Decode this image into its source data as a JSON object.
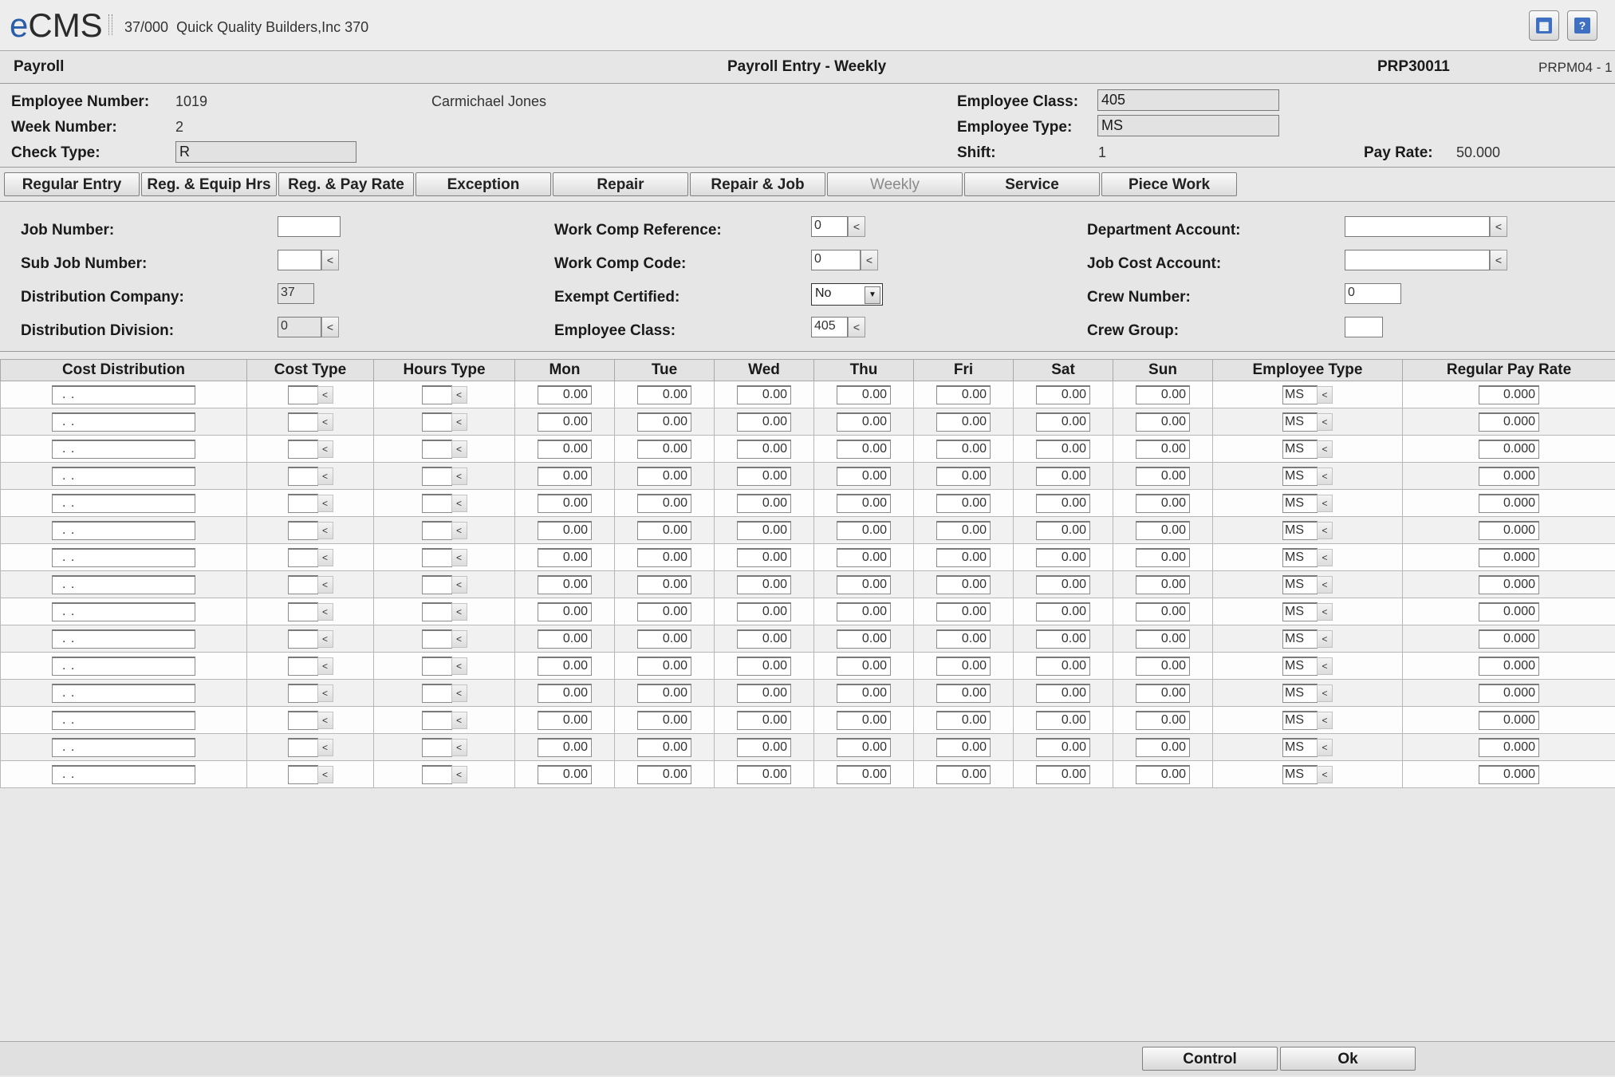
{
  "app": {
    "logo": "eCMS",
    "company_code": "37/000",
    "company_name": "Quick Quality Builders,Inc 370"
  },
  "title_bar": {
    "module": "Payroll",
    "screen": "Payroll Entry - Weekly",
    "program": "PRP30011",
    "screen_id": "PRPM04 - 1"
  },
  "header": {
    "employee_number_label": "Employee Number:",
    "employee_number": "1019",
    "employee_name": "Carmichael Jones",
    "week_number_label": "Week Number:",
    "week_number": "2",
    "check_type_label": "Check Type:",
    "check_type": "R",
    "employee_class_label": "Employee Class:",
    "employee_class": "405",
    "employee_type_label": "Employee Type:",
    "employee_type": "MS",
    "shift_label": "Shift:",
    "shift": "1",
    "pay_rate_label": "Pay Rate:",
    "pay_rate": "50.000"
  },
  "tabs": [
    {
      "label": "Regular Entry",
      "enabled": true
    },
    {
      "label": "Reg. & Equip Hrs",
      "enabled": true
    },
    {
      "label": "Reg. & Pay Rate",
      "enabled": true
    },
    {
      "label": "Exception",
      "enabled": true
    },
    {
      "label": "Repair",
      "enabled": true
    },
    {
      "label": "Repair & Job",
      "enabled": true
    },
    {
      "label": "Weekly",
      "enabled": false
    },
    {
      "label": "Service",
      "enabled": true
    },
    {
      "label": "Piece Work",
      "enabled": true
    }
  ],
  "form": {
    "job_number_label": "Job Number:",
    "job_number": "",
    "sub_job_number_label": "Sub Job Number:",
    "sub_job_number": "",
    "distribution_company_label": "Distribution Company:",
    "distribution_company": "37",
    "distribution_division_label": "Distribution Division:",
    "distribution_division": "0",
    "work_comp_reference_label": "Work Comp Reference:",
    "work_comp_reference": "0",
    "work_comp_code_label": "Work Comp Code:",
    "work_comp_code": "0",
    "exempt_certified_label": "Exempt Certified:",
    "exempt_certified": "No",
    "employee_class_label": "Employee Class:",
    "employee_class": "405",
    "department_account_label": "Department Account:",
    "department_account": "",
    "job_cost_account_label": "Job Cost Account:",
    "job_cost_account": "",
    "crew_number_label": "Crew Number:",
    "crew_number": "0",
    "crew_group_label": "Crew Group:",
    "crew_group": ""
  },
  "grid": {
    "columns": [
      "Cost Distribution",
      "Cost Type",
      "Hours Type",
      "Mon",
      "Tue",
      "Wed",
      "Thu",
      "Fri",
      "Sat",
      "Sun",
      "Employee Type",
      "Regular Pay Rate"
    ],
    "rows": [
      {
        "cost_distribution": ".   .",
        "cost_type": "",
        "hours_type": "",
        "mon": "0.00",
        "tue": "0.00",
        "wed": "0.00",
        "thu": "0.00",
        "fri": "0.00",
        "sat": "0.00",
        "sun": "0.00",
        "employee_type": "MS",
        "regular_pay_rate": "0.000"
      },
      {
        "cost_distribution": ".   .",
        "cost_type": "",
        "hours_type": "",
        "mon": "0.00",
        "tue": "0.00",
        "wed": "0.00",
        "thu": "0.00",
        "fri": "0.00",
        "sat": "0.00",
        "sun": "0.00",
        "employee_type": "MS",
        "regular_pay_rate": "0.000"
      },
      {
        "cost_distribution": ".   .",
        "cost_type": "",
        "hours_type": "",
        "mon": "0.00",
        "tue": "0.00",
        "wed": "0.00",
        "thu": "0.00",
        "fri": "0.00",
        "sat": "0.00",
        "sun": "0.00",
        "employee_type": "MS",
        "regular_pay_rate": "0.000"
      },
      {
        "cost_distribution": ".   .",
        "cost_type": "",
        "hours_type": "",
        "mon": "0.00",
        "tue": "0.00",
        "wed": "0.00",
        "thu": "0.00",
        "fri": "0.00",
        "sat": "0.00",
        "sun": "0.00",
        "employee_type": "MS",
        "regular_pay_rate": "0.000"
      },
      {
        "cost_distribution": ".   .",
        "cost_type": "",
        "hours_type": "",
        "mon": "0.00",
        "tue": "0.00",
        "wed": "0.00",
        "thu": "0.00",
        "fri": "0.00",
        "sat": "0.00",
        "sun": "0.00",
        "employee_type": "MS",
        "regular_pay_rate": "0.000"
      },
      {
        "cost_distribution": ".   .",
        "cost_type": "",
        "hours_type": "",
        "mon": "0.00",
        "tue": "0.00",
        "wed": "0.00",
        "thu": "0.00",
        "fri": "0.00",
        "sat": "0.00",
        "sun": "0.00",
        "employee_type": "MS",
        "regular_pay_rate": "0.000"
      },
      {
        "cost_distribution": ".   .",
        "cost_type": "",
        "hours_type": "",
        "mon": "0.00",
        "tue": "0.00",
        "wed": "0.00",
        "thu": "0.00",
        "fri": "0.00",
        "sat": "0.00",
        "sun": "0.00",
        "employee_type": "MS",
        "regular_pay_rate": "0.000"
      },
      {
        "cost_distribution": ".   .",
        "cost_type": "",
        "hours_type": "",
        "mon": "0.00",
        "tue": "0.00",
        "wed": "0.00",
        "thu": "0.00",
        "fri": "0.00",
        "sat": "0.00",
        "sun": "0.00",
        "employee_type": "MS",
        "regular_pay_rate": "0.000"
      },
      {
        "cost_distribution": ".   .",
        "cost_type": "",
        "hours_type": "",
        "mon": "0.00",
        "tue": "0.00",
        "wed": "0.00",
        "thu": "0.00",
        "fri": "0.00",
        "sat": "0.00",
        "sun": "0.00",
        "employee_type": "MS",
        "regular_pay_rate": "0.000"
      },
      {
        "cost_distribution": ".   .",
        "cost_type": "",
        "hours_type": "",
        "mon": "0.00",
        "tue": "0.00",
        "wed": "0.00",
        "thu": "0.00",
        "fri": "0.00",
        "sat": "0.00",
        "sun": "0.00",
        "employee_type": "MS",
        "regular_pay_rate": "0.000"
      },
      {
        "cost_distribution": ".   .",
        "cost_type": "",
        "hours_type": "",
        "mon": "0.00",
        "tue": "0.00",
        "wed": "0.00",
        "thu": "0.00",
        "fri": "0.00",
        "sat": "0.00",
        "sun": "0.00",
        "employee_type": "MS",
        "regular_pay_rate": "0.000"
      },
      {
        "cost_distribution": ".   .",
        "cost_type": "",
        "hours_type": "",
        "mon": "0.00",
        "tue": "0.00",
        "wed": "0.00",
        "thu": "0.00",
        "fri": "0.00",
        "sat": "0.00",
        "sun": "0.00",
        "employee_type": "MS",
        "regular_pay_rate": "0.000"
      },
      {
        "cost_distribution": ".   .",
        "cost_type": "",
        "hours_type": "",
        "mon": "0.00",
        "tue": "0.00",
        "wed": "0.00",
        "thu": "0.00",
        "fri": "0.00",
        "sat": "0.00",
        "sun": "0.00",
        "employee_type": "MS",
        "regular_pay_rate": "0.000"
      },
      {
        "cost_distribution": ".   .",
        "cost_type": "",
        "hours_type": "",
        "mon": "0.00",
        "tue": "0.00",
        "wed": "0.00",
        "thu": "0.00",
        "fri": "0.00",
        "sat": "0.00",
        "sun": "0.00",
        "employee_type": "MS",
        "regular_pay_rate": "0.000"
      },
      {
        "cost_distribution": ".   .",
        "cost_type": "",
        "hours_type": "",
        "mon": "0.00",
        "tue": "0.00",
        "wed": "0.00",
        "thu": "0.00",
        "fri": "0.00",
        "sat": "0.00",
        "sun": "0.00",
        "employee_type": "MS",
        "regular_pay_rate": "0.000"
      }
    ]
  },
  "footer": {
    "control_label": "Control",
    "ok_label": "Ok"
  },
  "icons": {
    "lookup": "chevron-left-icon",
    "dropdown": "dropdown-arrow-icon",
    "window": "window-icon",
    "help": "help-icon"
  },
  "colors": {
    "logo_accent": "#2a5da8",
    "icon_blue": "#3f70c2"
  }
}
